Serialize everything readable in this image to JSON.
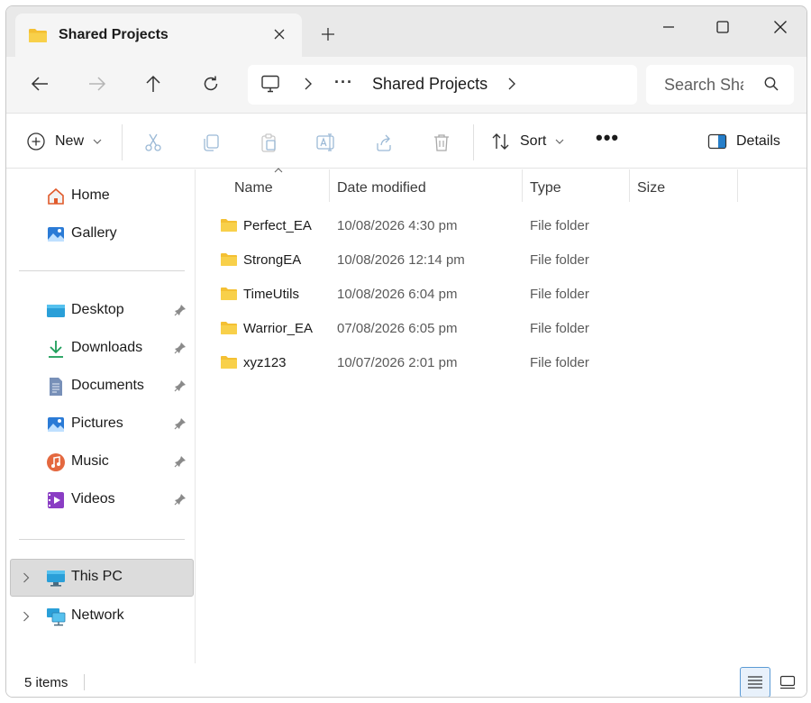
{
  "window": {
    "tab_title": "Shared Projects",
    "accent": "#0067c0",
    "folder_color": "#f4c033"
  },
  "navbar": {
    "address_more": "···",
    "address_current": "Shared Projects",
    "search_placeholder": "Search Sha"
  },
  "commandbar": {
    "new_label": "New",
    "sort_label": "Sort",
    "more_label": "•••",
    "details_label": "Details"
  },
  "sidebar": {
    "quick": [
      {
        "label": "Home",
        "icon": "home-icon"
      },
      {
        "label": "Gallery",
        "icon": "gallery-icon"
      }
    ],
    "pinned": [
      {
        "label": "Desktop",
        "icon": "desktop-icon"
      },
      {
        "label": "Downloads",
        "icon": "downloads-icon"
      },
      {
        "label": "Documents",
        "icon": "documents-icon"
      },
      {
        "label": "Pictures",
        "icon": "pictures-icon"
      },
      {
        "label": "Music",
        "icon": "music-icon"
      },
      {
        "label": "Videos",
        "icon": "videos-icon"
      }
    ],
    "locations": [
      {
        "label": "This PC",
        "icon": "this-pc-icon",
        "selected": true
      },
      {
        "label": "Network",
        "icon": "network-icon",
        "selected": false
      }
    ]
  },
  "filelist": {
    "columns": [
      "Name",
      "Date modified",
      "Type",
      "Size"
    ],
    "rows": [
      {
        "name": "Perfect_EA",
        "date": "10/08/2026 4:30 pm",
        "type": "File folder",
        "size": ""
      },
      {
        "name": "StrongEA",
        "date": "10/08/2026 12:14 pm",
        "type": "File folder",
        "size": ""
      },
      {
        "name": "TimeUtils",
        "date": "10/08/2026 6:04 pm",
        "type": "File folder",
        "size": ""
      },
      {
        "name": "Warrior_EA",
        "date": "07/08/2026 6:05 pm",
        "type": "File folder",
        "size": ""
      },
      {
        "name": "xyz123",
        "date": "10/07/2026 2:01 pm",
        "type": "File folder",
        "size": ""
      }
    ]
  },
  "statusbar": {
    "item_count": "5 items"
  }
}
